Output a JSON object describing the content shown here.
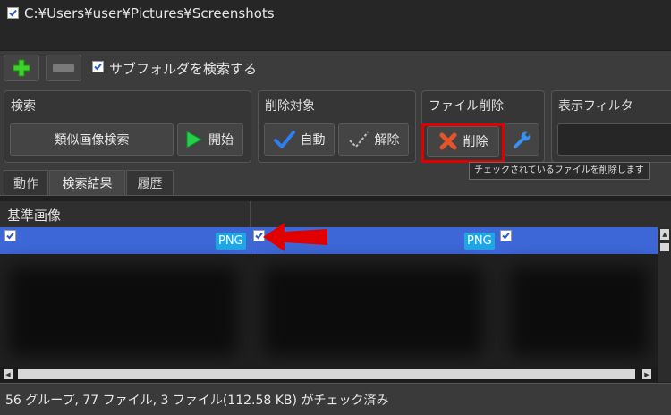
{
  "folder_list": {
    "path": "C:¥Users¥user¥Pictures¥Screenshots",
    "checked": true
  },
  "toolbar": {
    "add_icon": "plus-icon",
    "remove_icon": "minus-icon",
    "subfolder_label": "サブフォルダを検索する",
    "subfolder_checked": true
  },
  "groups": {
    "search": {
      "title": "検索",
      "similar_label": "類似画像検索",
      "start_label": "開始"
    },
    "target": {
      "title": "削除対象",
      "auto_label": "自動",
      "clear_label": "解除"
    },
    "delete": {
      "title": "ファイル削除",
      "delete_label": "削除",
      "tooltip": "チェックされているファイルを削除します"
    },
    "filter": {
      "title": "表示フィルタ"
    }
  },
  "tabs": [
    {
      "label": "動作",
      "active": false
    },
    {
      "label": "検索結果",
      "active": true
    },
    {
      "label": "履歴",
      "active": false
    }
  ],
  "results": {
    "column_header": "基準画像",
    "badge1": "PNG",
    "badge2": "PNG"
  },
  "status": {
    "text": "56 グループ, 77 ファイル, 3 ファイル(112.58 KB) がチェック済み"
  },
  "colors": {
    "accent": "#3d66d6",
    "badge": "#1ea7e6",
    "highlight": "#e00000"
  }
}
